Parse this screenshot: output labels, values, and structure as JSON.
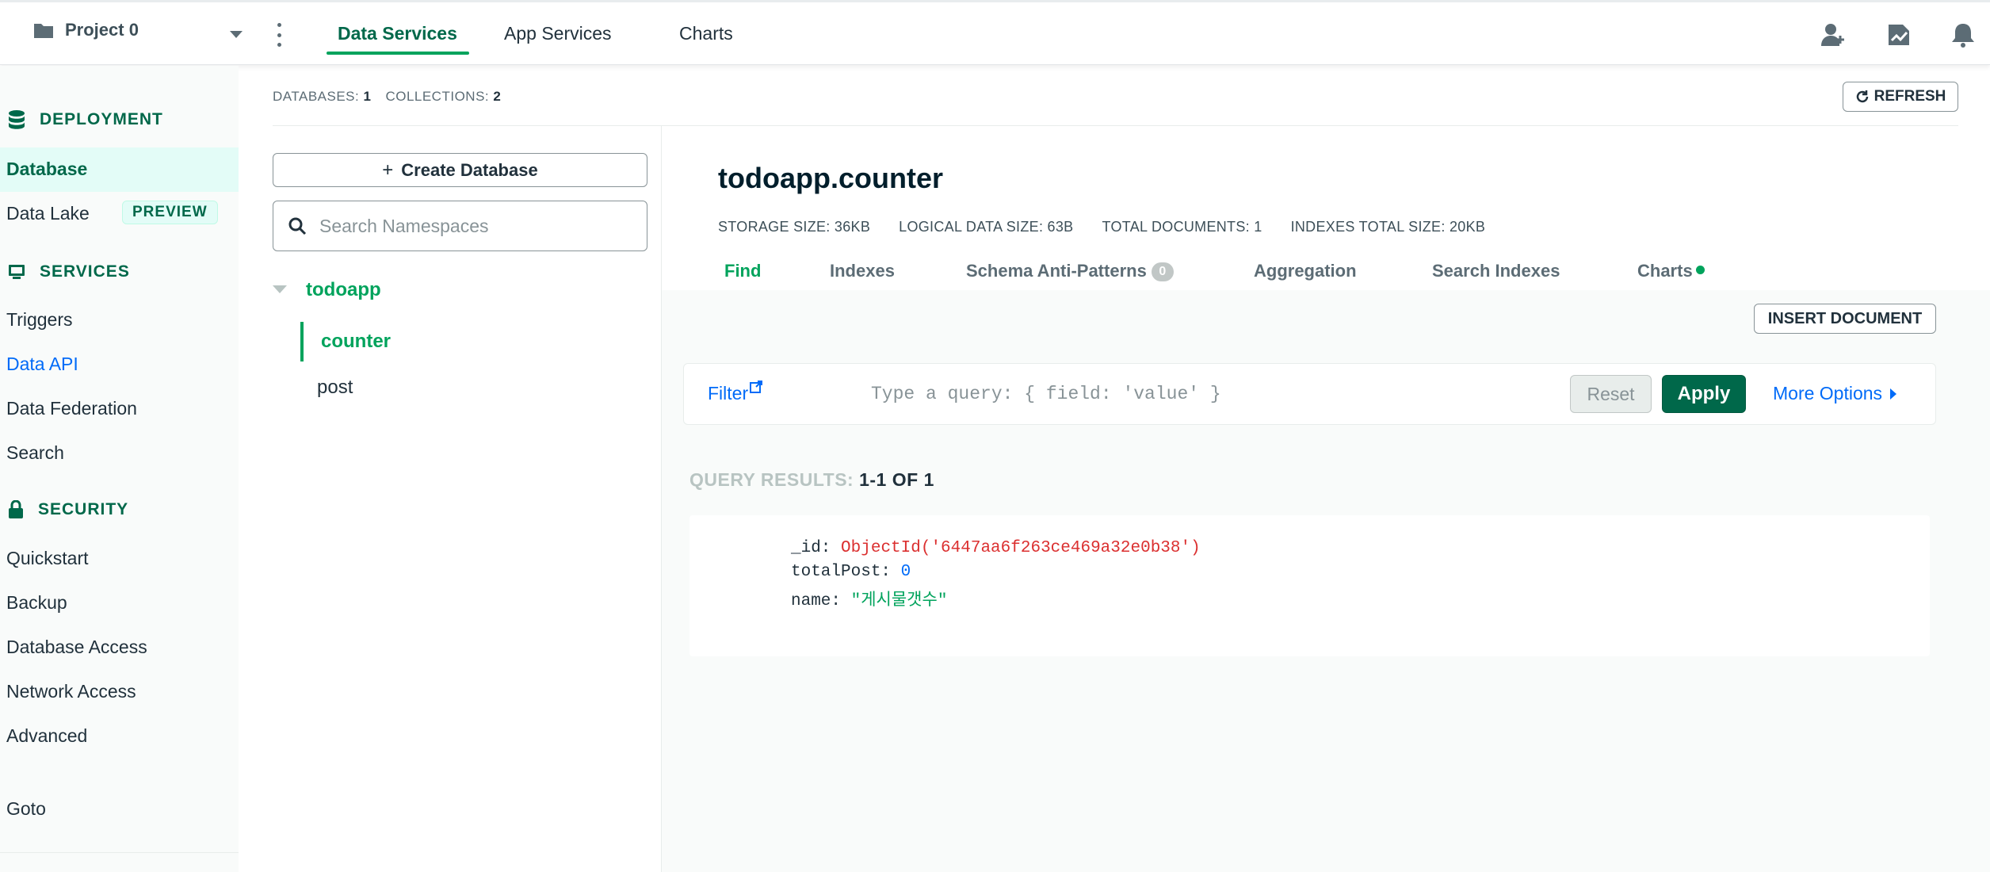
{
  "topbar": {
    "project": "Project 0",
    "tabs": [
      "Data Services",
      "App Services",
      "Charts"
    ]
  },
  "sidebar": {
    "deployment_heading": "DEPLOYMENT",
    "database": "Database",
    "data_lake": "Data Lake",
    "preview_badge": "PREVIEW",
    "services_heading": "SERVICES",
    "triggers": "Triggers",
    "data_api": "Data API",
    "data_federation": "Data Federation",
    "search": "Search",
    "security_heading": "SECURITY",
    "quickstart": "Quickstart",
    "backup": "Backup",
    "database_access": "Database Access",
    "network_access": "Network Access",
    "advanced": "Advanced",
    "goto": "Goto"
  },
  "stats": {
    "databases_label": "DATABASES:",
    "databases_value": "1",
    "collections_label": "COLLECTIONS:",
    "collections_value": "2",
    "refresh": "REFRESH"
  },
  "namespaces": {
    "create_db": "Create Database",
    "search_placeholder": "Search Namespaces",
    "db_name": "todoapp",
    "collections": [
      "counter",
      "post"
    ]
  },
  "collection": {
    "title": "todoapp.counter",
    "storage_size": "STORAGE SIZE: 36KB",
    "logical_size": "LOGICAL DATA SIZE: 63B",
    "total_docs": "TOTAL DOCUMENTS: 1",
    "indexes_size": "INDEXES TOTAL SIZE: 20KB",
    "tabs": [
      "Find",
      "Indexes",
      "Schema Anti-Patterns",
      "Aggregation",
      "Search Indexes",
      "Charts"
    ],
    "anti_patterns_count": "0",
    "insert_document": "INSERT DOCUMENT"
  },
  "filter": {
    "label": "Filter",
    "placeholder": "Type a query: { field: 'value' }",
    "reset": "Reset",
    "apply": "Apply",
    "more_options": "More Options"
  },
  "results": {
    "label": "QUERY RESULTS:",
    "range": "1-1 OF 1",
    "document": {
      "id_key": "_id:",
      "id_value": "ObjectId('6447aa6f263ce469a32e0b38')",
      "total_key": "totalPost:",
      "total_value": "0",
      "name_key": "name:",
      "name_value": "\"게시물갯수\""
    }
  },
  "colors": {
    "brand_green": "#00684a",
    "accent_green": "#00a35c",
    "link_blue": "#016bf8",
    "oid_red": "#db3030"
  }
}
